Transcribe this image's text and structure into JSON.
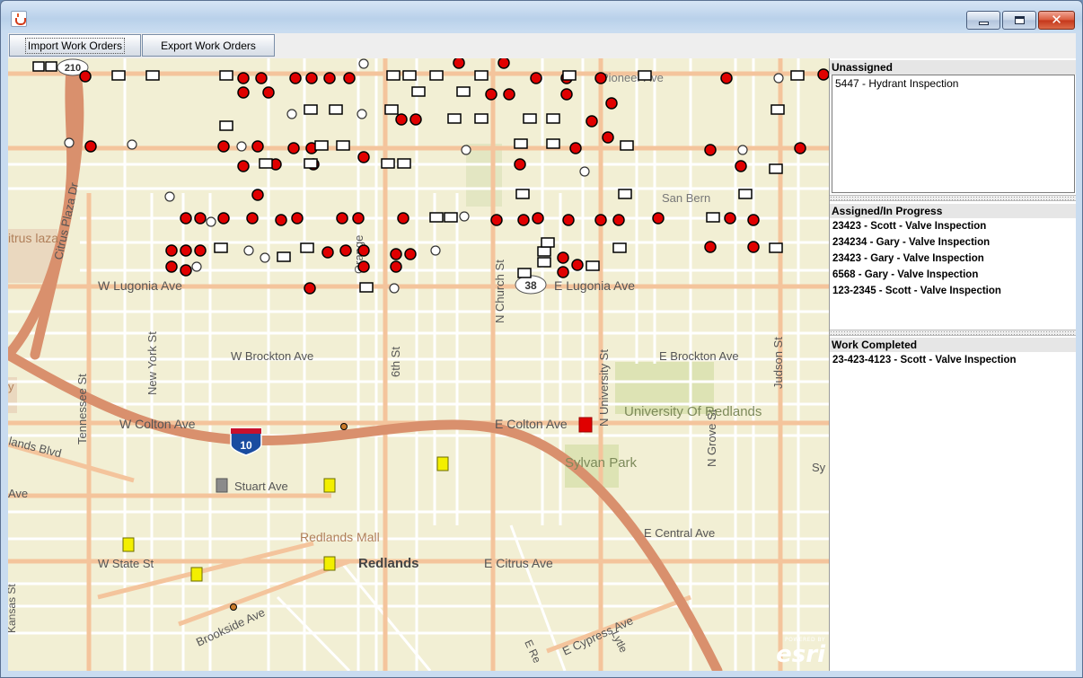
{
  "window": {
    "title": "",
    "buttons": {
      "minimize": "minimize",
      "maximize": "maximize",
      "close": "close"
    }
  },
  "toolbar": {
    "import_label": "Import Work Orders",
    "export_label": "Export Work Orders"
  },
  "map": {
    "streets": {
      "lugonia_w": "W Lugonia Ave",
      "lugonia_e": "E Lugonia Ave",
      "brockton_w": "W Brockton Ave",
      "brockton_e": "E Brockton Ave",
      "colton_w": "W Colton Ave",
      "colton_e": "E Colton Ave",
      "stuart": "Stuart Ave",
      "state": "W State St",
      "citrus_e": "E Citrus Ave",
      "central_e": "E Central Ave",
      "cypress_e": "E Cypress Ave",
      "brookside": "Brookside Ave",
      "tennessee": "Tennessee St",
      "new_york": "New York St",
      "sixth": "6th St",
      "church": "N Church St",
      "university_st": "N University St",
      "grove": "N Grove St",
      "judson": "Judson St",
      "citrus_plaza": "Citrus Plaza Dr",
      "orange": "Orange",
      "san_bern": "San Bern",
      "pioneer": "Pioneer Ave",
      "lands_blvd": "lands Blvd",
      "kansas": "Kansas St",
      "e_re": "E Re",
      "lytle": "Lytle",
      "sy": "Sy",
      "ave_frag": "Ave"
    },
    "places": {
      "redlands": "Redlands",
      "redlands_mall": "Redlands Mall",
      "university": "University Of Redlands",
      "sylvan_park": "Sylvan Park",
      "citrus_plaza": "itrus laza",
      "fragment_y": "y"
    },
    "shields": {
      "i10": "10",
      "route38": "38",
      "route210": "210"
    },
    "attribution": {
      "powered_by": "POWERED BY",
      "brand": "esri"
    },
    "colors": {
      "land": "#f2efd4",
      "freeway": "#d9906d",
      "major_road": "#f4c49c",
      "minor_road": "#ffffff",
      "park": "#dde3b4",
      "marker_red": "#e00000",
      "marker_yellow": "#f3ef00",
      "marker_gray": "#8b8b8b"
    }
  },
  "panels": {
    "unassigned": {
      "title": "Unassigned",
      "items": [
        "5447 - Hydrant Inspection"
      ]
    },
    "assigned": {
      "title": "Assigned/In Progress",
      "items": [
        "23423 - Scott - Valve Inspection",
        "234234 - Gary - Valve Inspection",
        "23423 - Gary - Valve Inspection",
        "6568 - Gary - Valve Inspection",
        "123-2345 - Scott - Valve Inspection"
      ]
    },
    "completed": {
      "title": "Work Completed",
      "items": [
        "23-423-4123 - Scott - Valve Inspection"
      ]
    }
  }
}
